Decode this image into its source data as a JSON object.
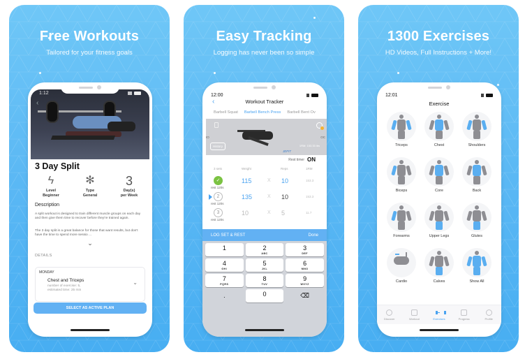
{
  "colors": {
    "panel_bg": "#5bb8f4",
    "accent": "#4aa3f0",
    "button": "#62b1f3",
    "check_green": "#7bc342",
    "muscle_gray": "#8e8e93",
    "muscle_highlight": "#5aaef0"
  },
  "panels": [
    {
      "headline": "Free Workouts",
      "subline": "Tailored for your fitness goals"
    },
    {
      "headline": "Easy Tracking",
      "subline": "Logging has never been so simple"
    },
    {
      "headline": "1300 Exercises",
      "subline": "HD Videos, Full Instructions + More!"
    }
  ],
  "plan": {
    "time": "1:12",
    "title": "3 Day Split",
    "stats": [
      {
        "icon": "lightning-icon",
        "label": "Level",
        "value": "Beginner"
      },
      {
        "icon": "figure-icon",
        "label": "Type",
        "value": "General"
      },
      {
        "big": "3",
        "label": "Day(s)",
        "value": "per Week"
      }
    ],
    "description_heading": "Description",
    "description_1": "A split workout is designed to train different muscle groups on each day and then give them time to recover before they're trained again.",
    "description_2": "The 3 day split is a great balance for those that want results, but don't have the time to spend more sessio ...",
    "details_heading": "DETAILS",
    "day": {
      "name": "MONDAY",
      "workout": "Chest and Triceps",
      "meta_1": "number of exercise: 5,",
      "meta_2": "estimated time: 25 min"
    },
    "cta": "SELECT AS ACTIVE PLAN"
  },
  "tracker": {
    "time": "12:00",
    "title": "Workout Tracker",
    "exercise_tabs": [
      "Barbell Squat",
      "Barbell Bench Press",
      "Barbell Bent Ov"
    ],
    "active_tab": 1,
    "video": {
      "history_label": "History",
      "left_edge": "IO",
      "right_edge": "OC",
      "calorie_text": "1RM: 153.33 lbs",
      "watermark": "JEFIT"
    },
    "rest_timer_label": "Rest timer",
    "rest_timer_value": "ON",
    "columns": {
      "sets": "3 sets",
      "weight": "Weight",
      "reps": "Reps",
      "rm": "1RM"
    },
    "sets": [
      {
        "num": "",
        "done": true,
        "rest": "rest 120s",
        "weight": "115",
        "reps": "10",
        "rm": "153.3"
      },
      {
        "num": "2",
        "done": false,
        "current": true,
        "rest": "rest 120s",
        "weight": "135",
        "reps": "10",
        "rm": "153.3"
      },
      {
        "num": "3",
        "done": false,
        "rest": "rest 120s",
        "weight": "10",
        "reps": "5",
        "rm": "11.7"
      }
    ],
    "x_sign": "X",
    "log_bar": {
      "label": "LOG SET & REST",
      "done": "Done"
    },
    "keypad": [
      {
        "n": "1",
        "l": ""
      },
      {
        "n": "2",
        "l": "ABC"
      },
      {
        "n": "3",
        "l": "DEF"
      },
      {
        "n": "4",
        "l": "GHI"
      },
      {
        "n": "5",
        "l": "JKL"
      },
      {
        "n": "6",
        "l": "MNO"
      },
      {
        "n": "7",
        "l": "PQRS"
      },
      {
        "n": "8",
        "l": "TUV"
      },
      {
        "n": "9",
        "l": "WXYZ"
      },
      {
        "n": ".",
        "l": ""
      },
      {
        "n": "0",
        "l": ""
      },
      {
        "n": "⌫",
        "l": ""
      }
    ]
  },
  "exercises": {
    "time": "12:01",
    "title": "Exercise",
    "groups": [
      "Triceps",
      "Chest",
      "Shoulders",
      "Biceps",
      "Core",
      "Back",
      "Forearms",
      "Upper Legs",
      "Glutes",
      "Cardio",
      "Calves",
      "Show All"
    ],
    "tabs": [
      "Discover",
      "Workout",
      "Exercises",
      "Progress",
      "Profile"
    ],
    "active_tab": 2
  }
}
